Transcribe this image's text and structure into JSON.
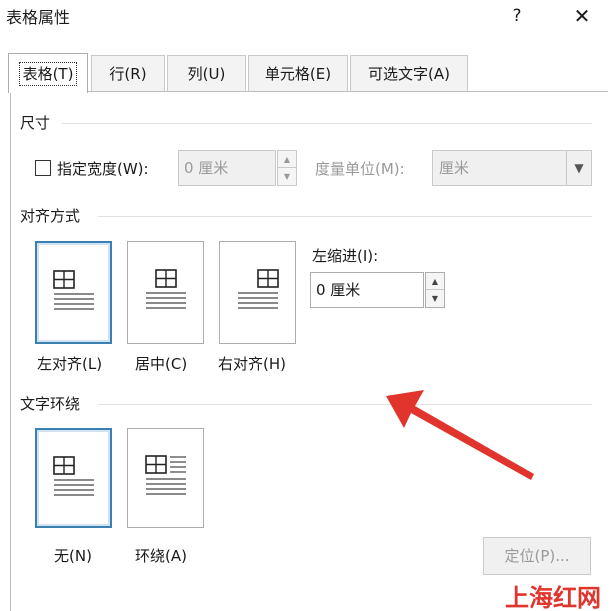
{
  "window": {
    "title": "表格属性",
    "help": "?",
    "close": "✕"
  },
  "tabs": [
    {
      "label": "表格(T)",
      "active": true
    },
    {
      "label": "行(R)"
    },
    {
      "label": "列(U)"
    },
    {
      "label": "单元格(E)"
    },
    {
      "label": "可选文字(A)"
    }
  ],
  "size": {
    "section": "尺寸",
    "checkbox_label": "指定宽度(W):",
    "checkbox_checked": false,
    "width_value": "0 厘米",
    "unit_label": "度量单位(M):",
    "unit_value": "厘米"
  },
  "alignment": {
    "section": "对齐方式",
    "options": [
      {
        "label": "左对齐(L)",
        "icon": "table-align-left-icon",
        "selected": true
      },
      {
        "label": "居中(C)",
        "icon": "table-align-center-icon",
        "selected": false
      },
      {
        "label": "右对齐(H)",
        "icon": "table-align-right-icon",
        "selected": false
      }
    ],
    "indent_label": "左缩进(I):",
    "indent_value": "0 厘米"
  },
  "wrapping": {
    "section": "文字环绕",
    "options": [
      {
        "label": "无(N)",
        "icon": "wrap-none-icon",
        "selected": true
      },
      {
        "label": "环绕(A)",
        "icon": "wrap-around-icon",
        "selected": false
      }
    ],
    "position_button": "定位(P)..."
  },
  "watermark": "上海红网",
  "colors": {
    "selected_border": "#3c7fb1",
    "arrow": "#e0342c",
    "disabled_text": "#9a9a9a"
  }
}
